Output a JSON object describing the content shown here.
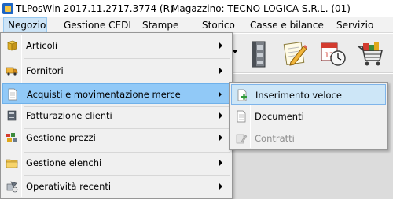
{
  "window": {
    "title": "TLPosWin 2017.11.2717.3774 (R)",
    "magazzino": "Magazzino: TECNO LOGICA S.R.L. (01)"
  },
  "menubar": [
    {
      "label": "Negozio",
      "active": true
    },
    {
      "label": "Gestione CEDI"
    },
    {
      "label": "Stampe"
    },
    {
      "label": "Storico"
    },
    {
      "label": "Casse e bilance"
    },
    {
      "label": "Servizio"
    }
  ],
  "toolbar": {
    "icons": [
      "cabinet-icon",
      "notepad-pencil-icon",
      "calendar-clock-icon",
      "shopping-cart-icon"
    ]
  },
  "dropdown": {
    "items": [
      {
        "label": "Articoli",
        "icon": "box-icon",
        "submenu": true
      },
      {
        "label": "Fornitori",
        "icon": "truck-icon",
        "submenu": true
      },
      {
        "label": "Acquisti e movimentazione merce",
        "icon": "document-icon",
        "submenu": true,
        "highlighted": true
      },
      {
        "label": "Fatturazione clienti",
        "icon": "invoice-icon",
        "submenu": true
      },
      {
        "label": "Gestione prezzi",
        "icon": "price-tags-icon",
        "submenu": true
      },
      {
        "label": "Gestione elenchi",
        "icon": "folder-icon",
        "submenu": true
      },
      {
        "label": "Operatività recenti",
        "icon": "recent-icon",
        "submenu": true
      }
    ]
  },
  "submenu": {
    "items": [
      {
        "label": "Inserimento veloce",
        "icon": "add-document-icon",
        "highlighted": true
      },
      {
        "label": "Documenti",
        "icon": "documents-icon"
      },
      {
        "label": "Contratti",
        "icon": "contracts-icon",
        "disabled": true
      }
    ]
  },
  "colors": {
    "menu_highlight": "#91c9f7",
    "submenu_highlight": "#cde6f7",
    "menubar_active": "#cce4f7"
  }
}
